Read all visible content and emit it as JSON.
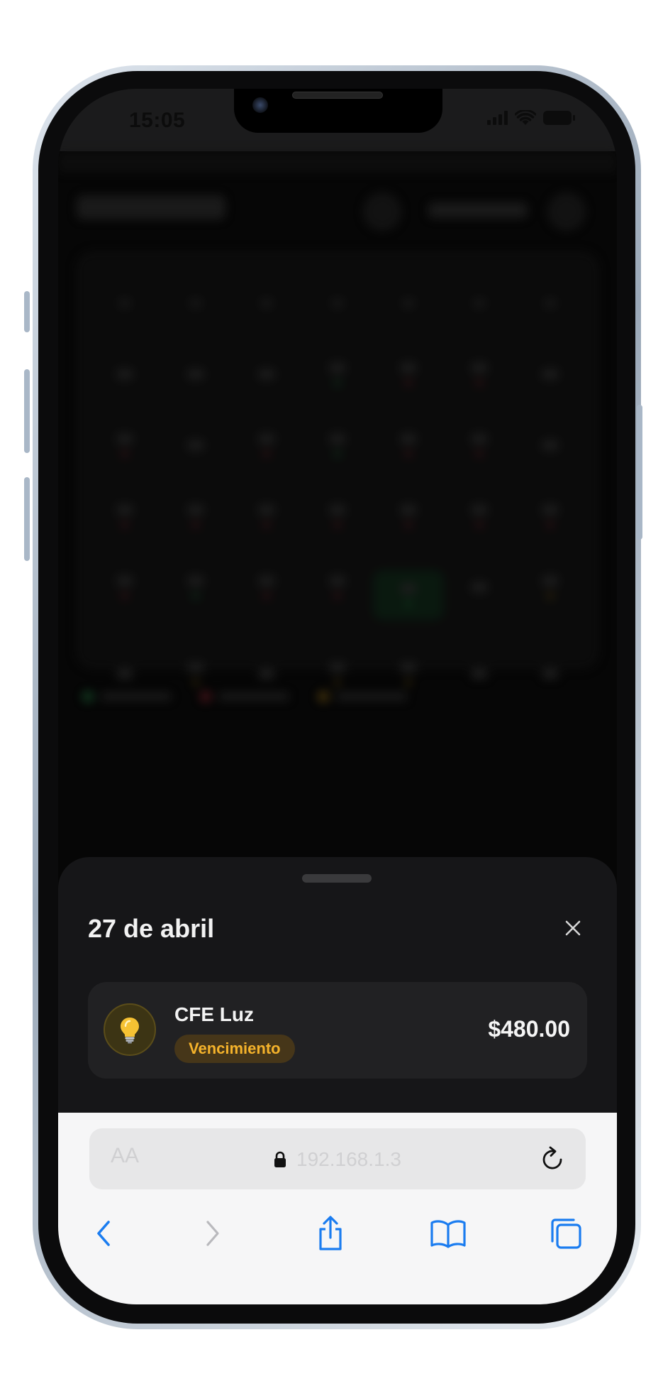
{
  "status_bar": {
    "time": "15:05",
    "icons": [
      "signal-icon",
      "wifi-icon",
      "battery-icon"
    ]
  },
  "sheet": {
    "date_title": "27 de abril",
    "close_icon": "close-icon",
    "items": [
      {
        "icon": "lightbulb-icon",
        "name": "CFE Luz",
        "badge": "Vencimiento",
        "amount": "$480.00"
      }
    ]
  },
  "safari": {
    "text_size_label": "AA",
    "url": "192.168.1.3",
    "icons": [
      "lock-icon",
      "reload-icon",
      "back-icon",
      "forward-icon",
      "share-icon",
      "bookmarks-icon",
      "tabs-icon"
    ]
  },
  "colors": {
    "sheet_bg": "#161618",
    "card_bg": "#212123",
    "badge_bg": "#463619",
    "badge_text": "#f5b32b",
    "safari_accent": "#1a7cf0"
  }
}
